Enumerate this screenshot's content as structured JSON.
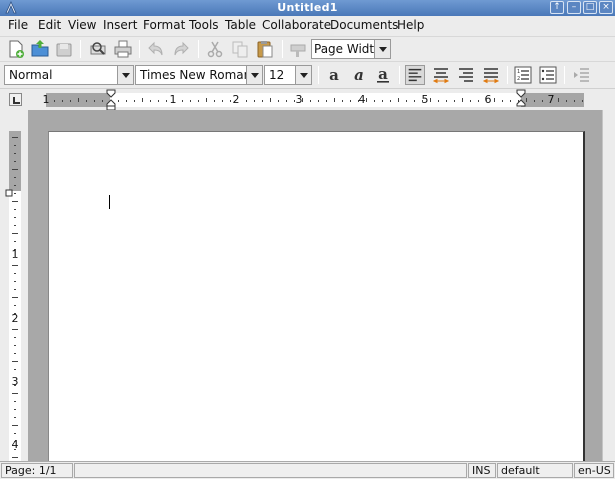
{
  "window": {
    "title": "Untitled1"
  },
  "menu": [
    "File",
    "Edit",
    "View",
    "Insert",
    "Format",
    "Tools",
    "Table",
    "Collaborate",
    "Documents",
    "Help"
  ],
  "toolbar": {
    "zoom_value": "Page Width"
  },
  "format_bar": {
    "style": "Normal",
    "font": "Times New Roman",
    "size": "12"
  },
  "ruler": {
    "h_numbers": [
      "1",
      "1",
      "2",
      "3",
      "4",
      "5",
      "6",
      "7"
    ],
    "v_numbers": [
      "1",
      "2",
      "3",
      "4"
    ]
  },
  "status": {
    "page": "Page: 1/1",
    "mode": "INS",
    "style": "default",
    "lang": "en-US"
  },
  "colors": {
    "title_bar": "#4a78b8",
    "workspace": "#a8a8a8",
    "margin": "#a6a6a6"
  }
}
